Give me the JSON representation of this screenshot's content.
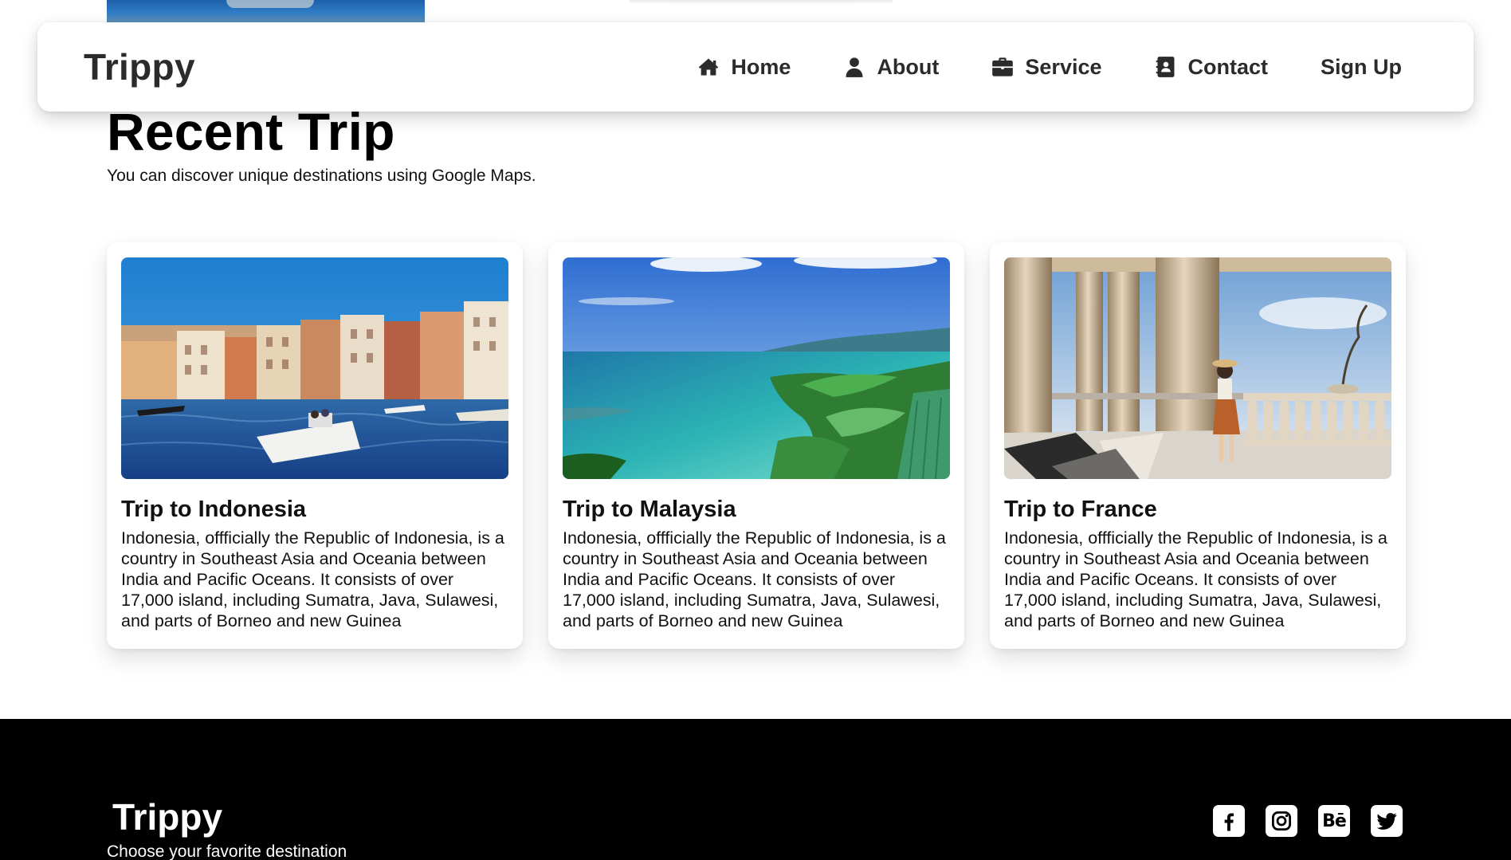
{
  "navbar": {
    "brand": "Trippy",
    "links": [
      {
        "label": "Home",
        "icon": "home-icon"
      },
      {
        "label": "About",
        "icon": "user-icon"
      },
      {
        "label": "Service",
        "icon": "briefcase-icon"
      },
      {
        "label": "Contact",
        "icon": "address-book-icon"
      },
      {
        "label": "Sign Up"
      }
    ]
  },
  "section": {
    "title": "Recent Trip",
    "subtitle": "You can discover unique destinations using Google Maps."
  },
  "cards": [
    {
      "title": "Trip to Indonesia",
      "text": "Indonesia, offficially the Republic of Indonesia, is a country in Southeast Asia and Oceania between India and Pacific Oceans. It consists of over 17,000 island, including Sumatra, Java, Sulawesi, and parts of Borneo and new Guinea",
      "image": "venice-canal-photo"
    },
    {
      "title": "Trip to Malaysia",
      "text": "Indonesia, offficially the Republic of Indonesia, is a country in Southeast Asia and Oceania between India and Pacific Oceans. It consists of over 17,000 island, including Sumatra, Java, Sulawesi, and parts of Borneo and new Guinea",
      "image": "tropical-coast-photo"
    },
    {
      "title": "Trip to France",
      "text": "Indonesia, offficially the Republic of Indonesia, is a country in Southeast Asia and Oceania between India and Pacific Oceans. It consists of over 17,000 island, including Sumatra, Java, Sulawesi, and parts of Borneo and new Guinea",
      "image": "palace-terrace-photo"
    }
  ],
  "footer": {
    "brand": "Trippy",
    "tagline": "Choose your favorite destination",
    "socials": [
      "facebook-icon",
      "instagram-icon",
      "behance-icon",
      "twitter-icon"
    ],
    "background": "#000000"
  }
}
